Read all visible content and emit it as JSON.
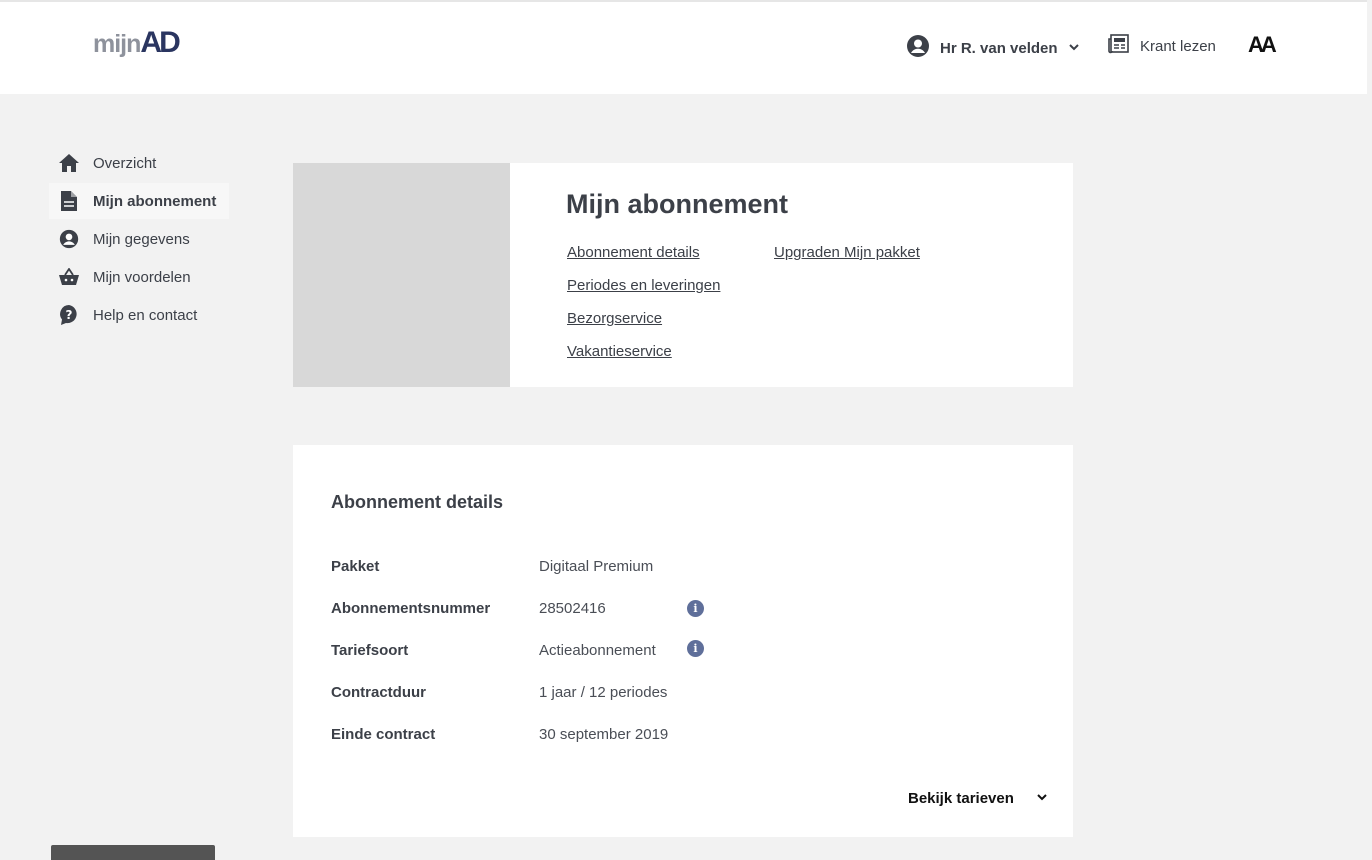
{
  "header": {
    "logo_mijn": "mijn",
    "logo_ad": "AD",
    "user_name": "Hr R. van velden",
    "krant_label": "Krant lezen",
    "font_toggle": "AA"
  },
  "sidebar": {
    "items": [
      {
        "label": "Overzicht",
        "icon": "home-icon"
      },
      {
        "label": "Mijn abonnement",
        "icon": "document-icon",
        "active": true
      },
      {
        "label": "Mijn gegevens",
        "icon": "user-icon"
      },
      {
        "label": "Mijn voordelen",
        "icon": "basket-icon"
      },
      {
        "label": "Help en contact",
        "icon": "help-icon"
      }
    ]
  },
  "subscription": {
    "title": "Mijn abonnement",
    "links": [
      "Abonnement details",
      "Periodes en leveringen",
      "Bezorgservice",
      "Vakantieservice"
    ],
    "upgrade_link": "Upgraden Mijn pakket"
  },
  "details": {
    "title": "Abonnement details",
    "rows": [
      {
        "label": "Pakket",
        "value": "Digitaal Premium"
      },
      {
        "label": "Abonnementsnummer",
        "value": "28502416"
      },
      {
        "label": "Tariefsoort",
        "value": "Actieabonnement"
      },
      {
        "label": "Contractduur",
        "value": "1 jaar / 12 periodes"
      },
      {
        "label": "Einde contract",
        "value": "30 september 2019"
      }
    ],
    "info_glyph": "i",
    "bekijk_label": "Bekijk tarieven"
  },
  "colors": {
    "accent_navy": "#2a3560",
    "text": "#3c4048",
    "background": "#f2f2f2"
  }
}
